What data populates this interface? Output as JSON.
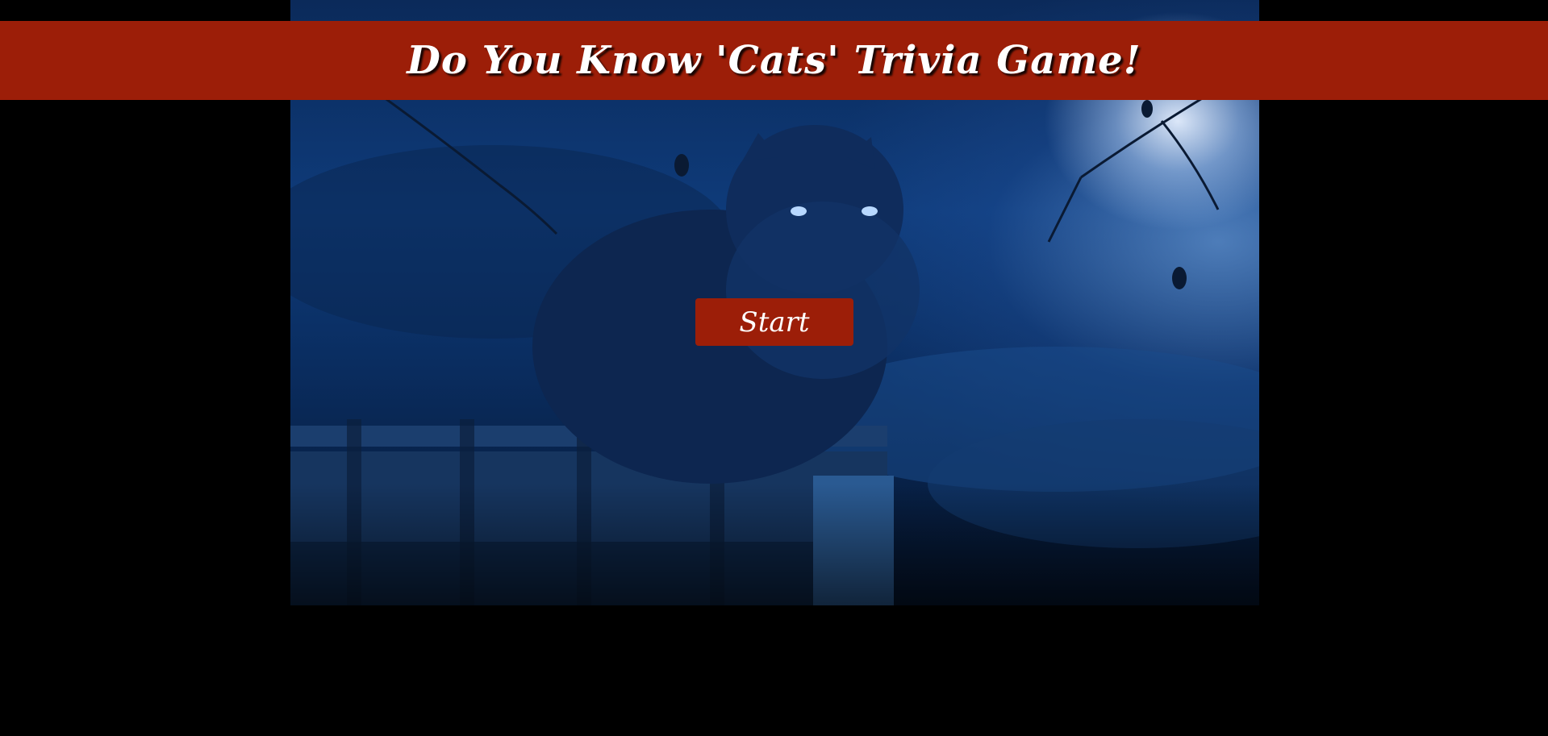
{
  "header": {
    "title": "Do You Know 'Cats' Trivia Game!"
  },
  "main": {
    "start_label": "Start"
  },
  "background": {
    "description_icon": "cat-on-fence-moonlit-image"
  },
  "colors": {
    "accent": "#9c1e08",
    "page_background": "#000000",
    "text": "#ffffff"
  }
}
